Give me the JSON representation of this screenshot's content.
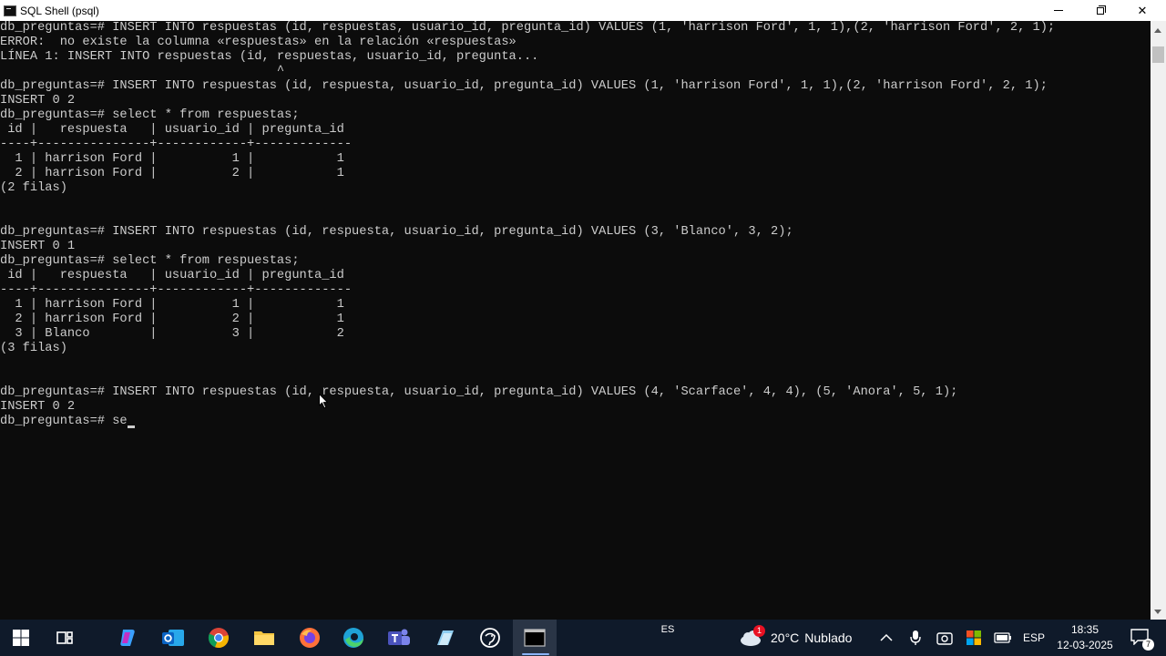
{
  "window": {
    "title": "SQL Shell (psql)"
  },
  "console": {
    "lines": [
      "db_preguntas=# INSERT INTO respuestas (id, respuestas, usuario_id, pregunta_id) VALUES (1, 'harrison Ford', 1, 1),(2, 'harrison Ford', 2, 1);",
      "ERROR:  no existe la columna «respuestas» en la relación «respuestas»",
      "LÍNEA 1: INSERT INTO respuestas (id, respuestas, usuario_id, pregunta...",
      "                                     ^",
      "db_preguntas=# INSERT INTO respuestas (id, respuesta, usuario_id, pregunta_id) VALUES (1, 'harrison Ford', 1, 1),(2, 'harrison Ford', 2, 1);",
      "INSERT 0 2",
      "db_preguntas=# select * from respuestas;",
      " id |   respuesta   | usuario_id | pregunta_id",
      "----+---------------+------------+-------------",
      "  1 | harrison Ford |          1 |           1",
      "  2 | harrison Ford |          2 |           1",
      "(2 filas)",
      "",
      "",
      "db_preguntas=# INSERT INTO respuestas (id, respuesta, usuario_id, pregunta_id) VALUES (3, 'Blanco', 3, 2);",
      "INSERT 0 1",
      "db_preguntas=# select * from respuestas;",
      " id |   respuesta   | usuario_id | pregunta_id",
      "----+---------------+------------+-------------",
      "  1 | harrison Ford |          1 |           1",
      "  2 | harrison Ford |          2 |           1",
      "  3 | Blanco        |          3 |           2",
      "(3 filas)",
      "",
      "",
      "db_preguntas=# INSERT INTO respuestas (id, respuesta, usuario_id, pregunta_id) VALUES (4, 'Scarface', 4, 4), (5, 'Anora', 5, 1);",
      "INSERT 0 2",
      "db_preguntas=# se"
    ]
  },
  "taskbar": {
    "apps": [
      {
        "name": "windows-start",
        "icon": "windows-logo-icon"
      },
      {
        "name": "task-view",
        "icon": "task-view-icon"
      },
      {
        "name": "copilot",
        "icon": "copilot-icon"
      },
      {
        "name": "outlook",
        "icon": "outlook-icon"
      },
      {
        "name": "chrome",
        "icon": "chrome-icon"
      },
      {
        "name": "file-explorer",
        "icon": "folder-icon"
      },
      {
        "name": "firefox",
        "icon": "firefox-icon"
      },
      {
        "name": "edge",
        "icon": "edge-icon"
      },
      {
        "name": "teams",
        "icon": "teams-icon"
      },
      {
        "name": "notes-app",
        "icon": "notes-icon"
      },
      {
        "name": "pgadmin",
        "icon": "elephant-icon"
      },
      {
        "name": "terminal",
        "icon": "terminal-icon",
        "active": true
      }
    ],
    "language_indicator": "ES",
    "weather": {
      "temperature": "20°C",
      "condition": "Nublado",
      "badge": "1"
    },
    "keyboard_layout": "ESP",
    "clock": {
      "time": "18:35",
      "date": "12-03-2025"
    },
    "notification_count": "7",
    "colors": {
      "background": "#0f1a2a",
      "accent": "#8ab4f8"
    }
  }
}
